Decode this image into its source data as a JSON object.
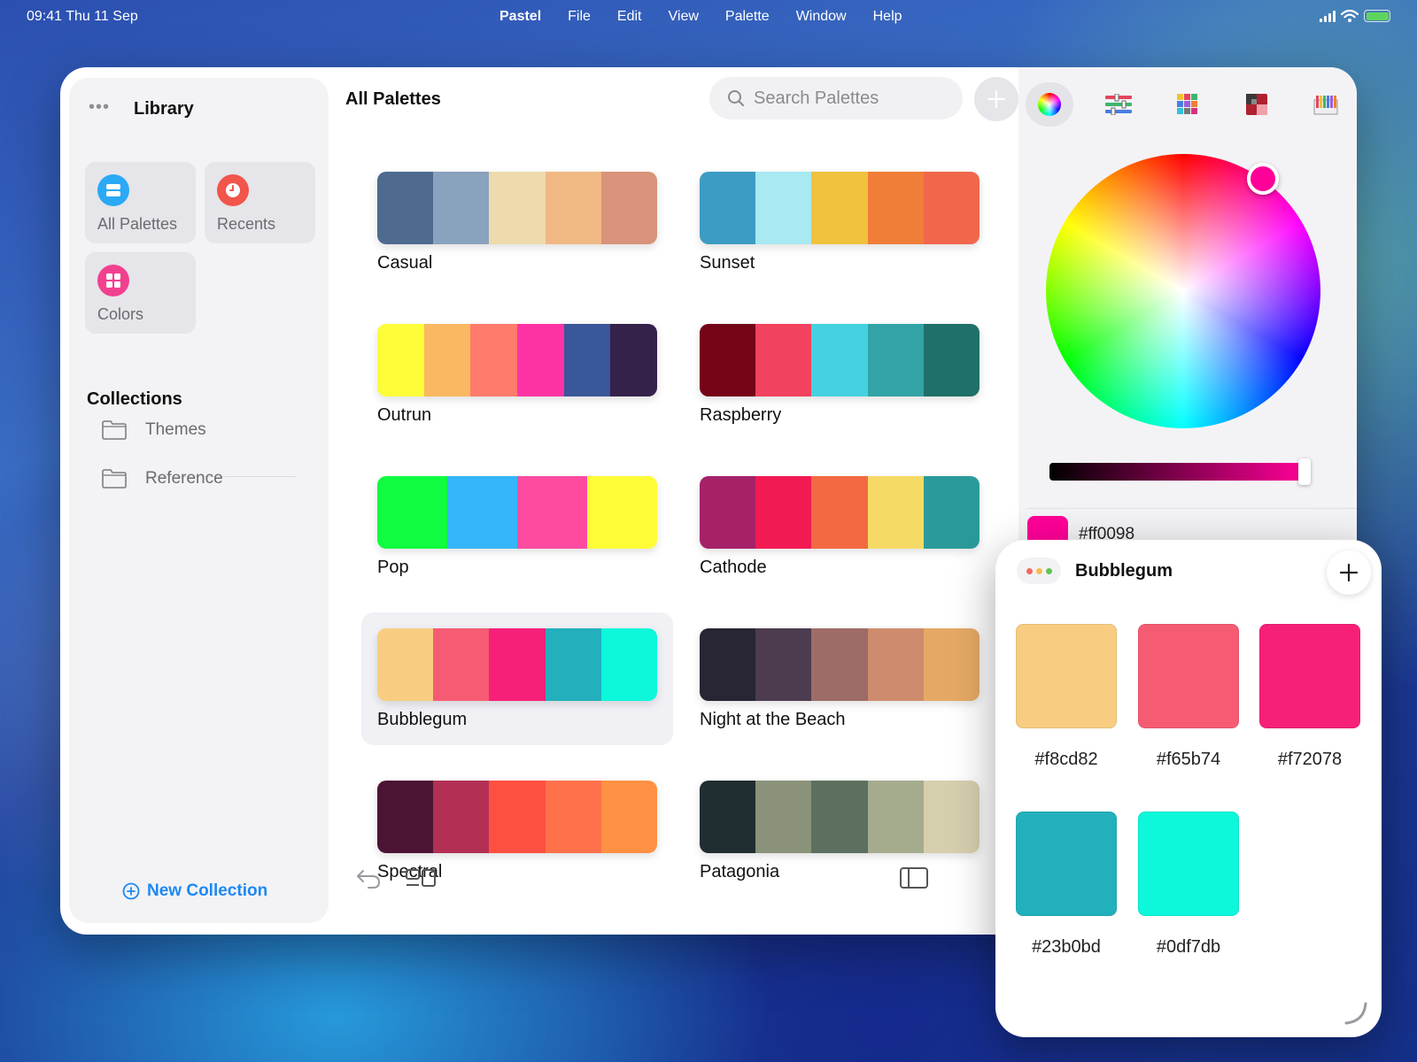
{
  "menubar": {
    "clock": "09:41  Thu 11 Sep",
    "menus": [
      "Pastel",
      "File",
      "Edit",
      "View",
      "Palette",
      "Window",
      "Help"
    ]
  },
  "sidebar": {
    "title": "Library",
    "tiles": [
      {
        "label": "All Palettes",
        "icon": "stack-icon",
        "color": "#2aa9f5"
      },
      {
        "label": "Recents",
        "icon": "clock-icon",
        "color": "#f2554a"
      },
      {
        "label": "Colors",
        "icon": "grid-icon",
        "color": "#f2408f"
      }
    ],
    "collections_heading": "Collections",
    "collections": [
      "Themes",
      "Reference"
    ],
    "new_collection": "New Collection"
  },
  "content": {
    "title": "All Palettes",
    "search_placeholder": "Search Palettes",
    "palettes": [
      {
        "name": "Casual",
        "colors": [
          "#4e6a8e",
          "#89a2bd",
          "#efdaae",
          "#f0b883",
          "#d8937a"
        ]
      },
      {
        "name": "Sunset",
        "colors": [
          "#3d9cc4",
          "#a8e9f2",
          "#f1c23d",
          "#f17e38",
          "#f1674b"
        ]
      },
      {
        "name": "Outrun",
        "colors": [
          "#fdfd3a",
          "#f9b861",
          "#ff7b6b",
          "#fd33a4",
          "#3a5799",
          "#35224a"
        ]
      },
      {
        "name": "Raspberry",
        "colors": [
          "#760418",
          "#f1425f",
          "#44d2e0",
          "#33a4a6",
          "#1f706a"
        ]
      },
      {
        "name": "Pop",
        "colors": [
          "#0ffc40",
          "#35b6fa",
          "#fe4ba0",
          "#fefc36"
        ]
      },
      {
        "name": "Cathode",
        "colors": [
          "#a52269",
          "#f11a52",
          "#f36a42",
          "#f6da66",
          "#2a9b9a"
        ]
      },
      {
        "name": "Bubblegum",
        "colors": [
          "#f8cd82",
          "#f65b74",
          "#f72078",
          "#23b0bd",
          "#0df7db"
        ],
        "selected": true
      },
      {
        "name": "Night at the Beach",
        "colors": [
          "#282534",
          "#4d3b50",
          "#9e6c66",
          "#cf8b6e",
          "#e6a965"
        ]
      },
      {
        "name": "Spectral",
        "colors": [
          "#4c1433",
          "#b33054",
          "#fe5040",
          "#fe714b",
          "#ff9144"
        ]
      },
      {
        "name": "Patagonia",
        "colors": [
          "#202d31",
          "#8a9379",
          "#5d6f5f",
          "#a5ab8d",
          "#d6cfae"
        ]
      }
    ]
  },
  "picker": {
    "tabs": [
      "color-wheel-icon",
      "sliders-icon",
      "swatch-grid-icon",
      "image-picker-icon",
      "pencils-icon"
    ],
    "current_color": "#ff0098",
    "hex_label": "#ff0098"
  },
  "float_window": {
    "title": "Bubblegum",
    "swatches": [
      {
        "hex": "#f8cd82"
      },
      {
        "hex": "#f65b74"
      },
      {
        "hex": "#f72078"
      },
      {
        "hex": "#23b0bd"
      },
      {
        "hex": "#0df7db"
      }
    ]
  }
}
